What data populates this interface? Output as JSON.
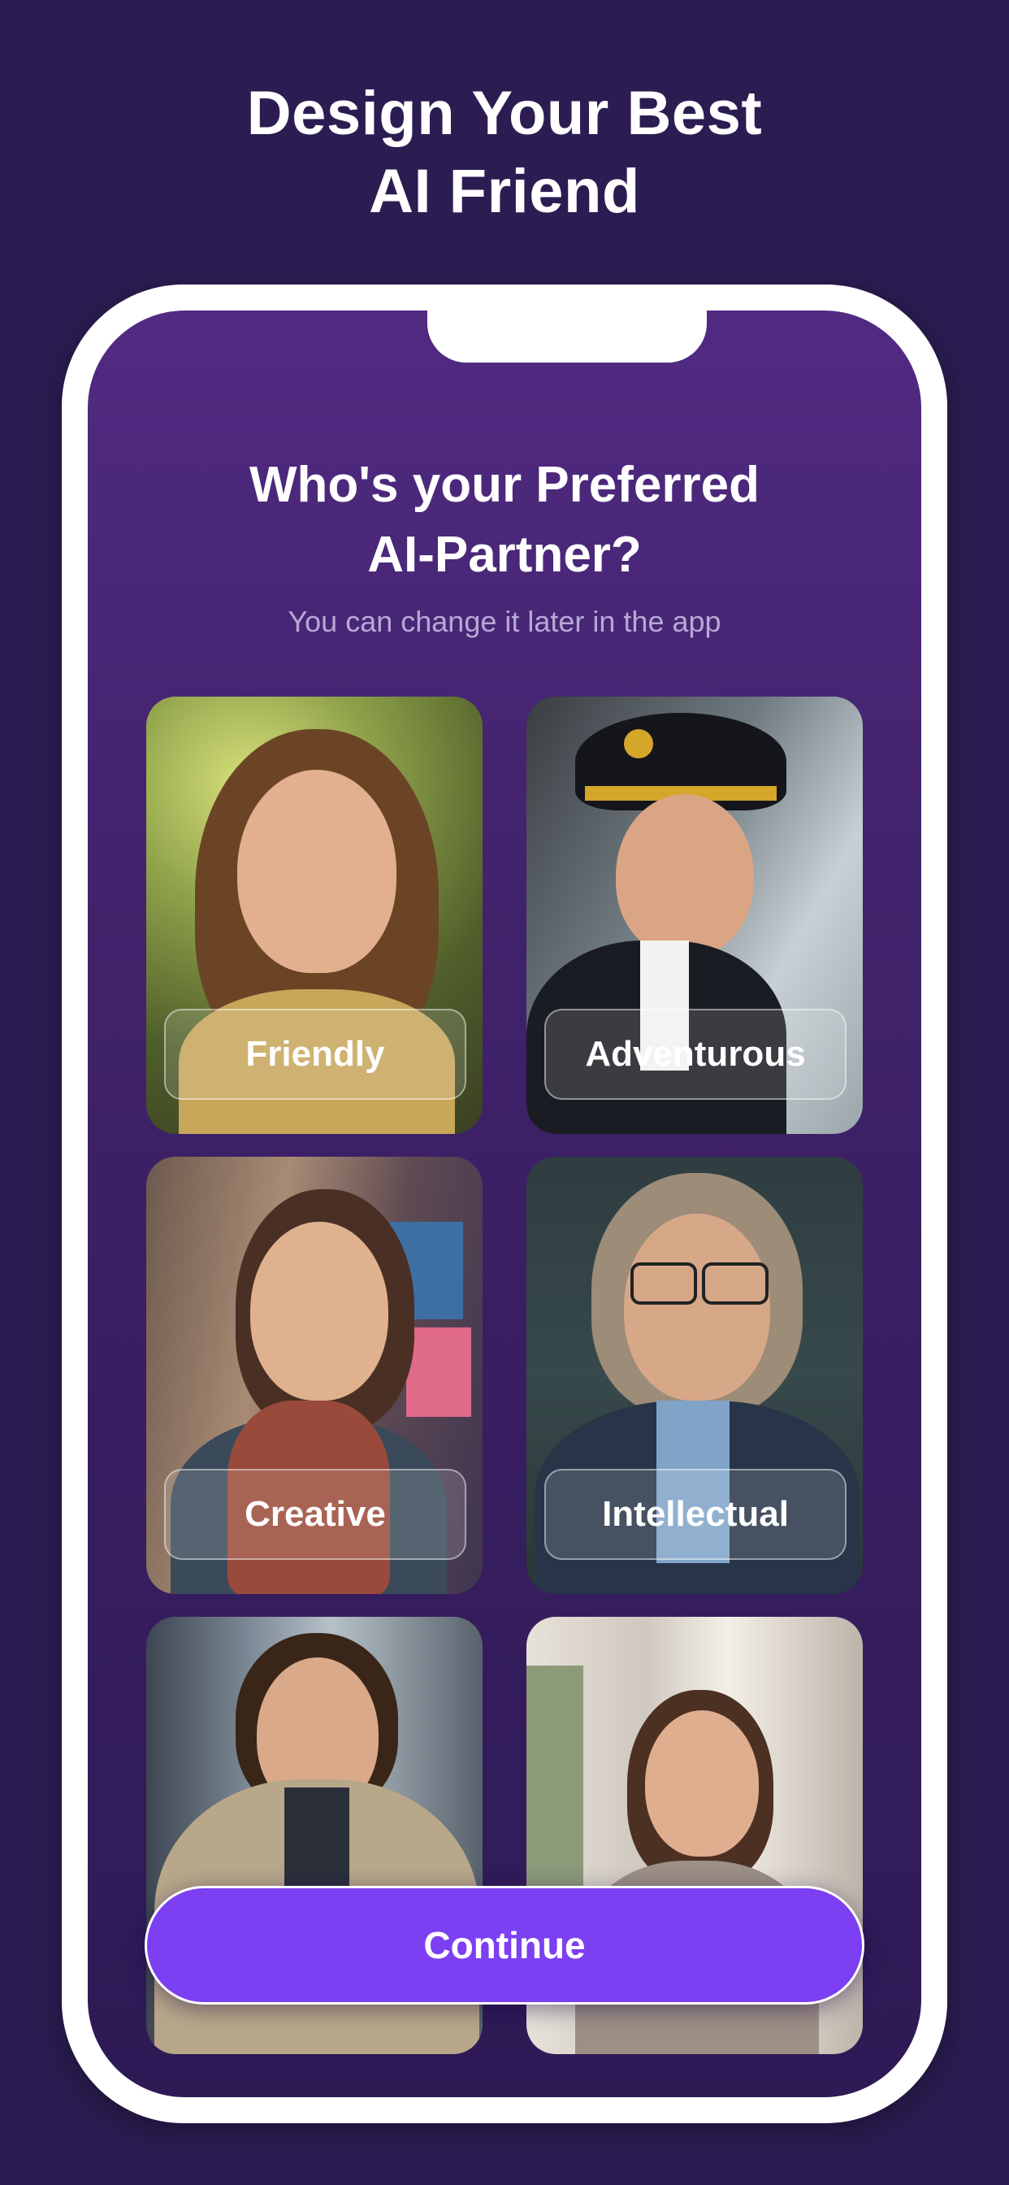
{
  "hero": {
    "title_line1": "Design Your Best",
    "title_line2": "AI Friend"
  },
  "screen": {
    "title_line1": "Who's your Preferred",
    "title_line2": "AI-Partner?",
    "subtitle": "You can change it later in the app"
  },
  "cards": [
    {
      "label": "Friendly"
    },
    {
      "label": "Adventurous"
    },
    {
      "label": "Creative"
    },
    {
      "label": "Intellectual"
    },
    {
      "label": ""
    },
    {
      "label": ""
    }
  ],
  "actions": {
    "continue_label": "Continue"
  },
  "colors": {
    "background": "#2b1d52",
    "screen_top": "#512a82",
    "accent_button": "#7c3ff2",
    "subtitle": "#b7a8d6"
  }
}
